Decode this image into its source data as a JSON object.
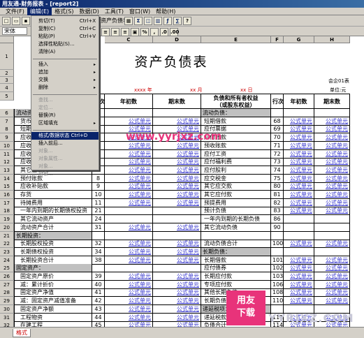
{
  "window": {
    "title": "用友通-财务报表 - [report2]"
  },
  "menubar": [
    "文件(F)",
    "编辑(E)",
    "格式(S)",
    "数据(D)",
    "工具(T)",
    "窗口(W)",
    "帮助(H)"
  ],
  "format_bar": {
    "font": "宋体"
  },
  "formula_hint": "资产负债表",
  "edit_menu": {
    "items": [
      {
        "label": "剪切(T)",
        "shortcut": "Ctrl+X",
        "state": "enabled"
      },
      {
        "label": "复制(C)",
        "shortcut": "Ctrl+C",
        "state": "enabled"
      },
      {
        "label": "粘贴(P)",
        "shortcut": "Ctrl+V",
        "state": "enabled"
      },
      {
        "label": "选择性粘贴(S)...",
        "shortcut": "",
        "state": "enabled"
      },
      {
        "label": "清除(A)",
        "shortcut": "",
        "state": "enabled"
      },
      {
        "label": "插入",
        "shortcut": "▸",
        "state": "enabled"
      },
      {
        "label": "追加",
        "shortcut": "▸",
        "state": "enabled"
      },
      {
        "label": "交换",
        "shortcut": "▸",
        "state": "enabled"
      },
      {
        "label": "删除",
        "shortcut": "▸",
        "state": "enabled"
      },
      {
        "label": "查找...",
        "shortcut": "",
        "state": "disabled"
      },
      {
        "label": "定位...",
        "shortcut": "",
        "state": "disabled"
      },
      {
        "label": "替换(R)",
        "shortcut": "",
        "state": "enabled"
      },
      {
        "label": "区域填充",
        "shortcut": "▸",
        "state": "enabled"
      },
      {
        "label": "格式/数据状态 Ctrl+D",
        "shortcut": "",
        "state": "selected"
      },
      {
        "label": "插入前后...",
        "shortcut": "",
        "state": "enabled"
      },
      {
        "label": "对象...",
        "shortcut": "",
        "state": "disabled"
      },
      {
        "label": "对象属性...",
        "shortcut": "",
        "state": "disabled"
      },
      {
        "label": "对象...",
        "shortcut": "",
        "state": "disabled"
      },
      {
        "label": "对象...",
        "shortcut": "",
        "state": "disabled"
      }
    ]
  },
  "sheet": {
    "columns": [
      "C",
      "D",
      "E",
      "F",
      "G",
      "H"
    ],
    "title": "资产负债表",
    "form_no": "会企01表",
    "unit": "单位:元",
    "year_label": "xxxx 年",
    "month_label": "xx 月",
    "day_label": "xx 日",
    "headers": {
      "row_no": "行次",
      "begin": "年初数",
      "end": "期末数",
      "liability": "负债和所有者权益",
      "liability2": "（或股东权益）",
      "row_no2": "行次",
      "begin2": "年初数",
      "end2": "期末数"
    },
    "formula_unit": "公式单元",
    "left_rows": [
      {
        "r": "6",
        "name": "流动资产：",
        "no": "",
        "f": false,
        "sec": true
      },
      {
        "r": "7",
        "name": "货币资金",
        "no": "",
        "f": true
      },
      {
        "r": "8",
        "name": "短期投资",
        "no": "",
        "f": true
      },
      {
        "r": "9",
        "name": "应收票据",
        "no": "",
        "f": true
      },
      {
        "r": "10",
        "name": "应收股利",
        "no": "",
        "f": true
      },
      {
        "r": "11",
        "name": "应收利息",
        "no": "",
        "f": true
      },
      {
        "r": "12",
        "name": "应收账款",
        "no": "",
        "f": true
      },
      {
        "r": "13",
        "name": "其它应收款",
        "no": "7",
        "f": true
      },
      {
        "r": "14",
        "name": "预付账款",
        "no": "8",
        "f": true
      },
      {
        "r": "15",
        "name": "应收补贴款",
        "no": "9",
        "f": true
      },
      {
        "r": "16",
        "name": "存货",
        "no": "10",
        "f": true
      },
      {
        "r": "17",
        "name": "待摊费用",
        "no": "11",
        "f": true
      },
      {
        "r": "18",
        "name": "一年内到期的长期债权投资",
        "no": "21",
        "f": false
      },
      {
        "r": "19",
        "name": "其它流动资产",
        "no": "24",
        "f": false
      },
      {
        "r": "20",
        "name": "流动资产合计",
        "no": "31",
        "f": true
      },
      {
        "r": "21",
        "name": "长期投资：",
        "no": "",
        "f": false,
        "sec": true
      },
      {
        "r": "22",
        "name": "长期股权投资",
        "no": "32",
        "f": true
      },
      {
        "r": "23",
        "name": "长期债权投资",
        "no": "34",
        "f": true
      },
      {
        "r": "24",
        "name": "长期投资合计",
        "no": "38",
        "f": true
      },
      {
        "r": "25",
        "name": "固定资产：",
        "no": "",
        "f": false,
        "sec": true
      },
      {
        "r": "26",
        "name": "固定资产原价",
        "no": "39",
        "f": true
      },
      {
        "r": "27",
        "name": "减：累计折价",
        "no": "40",
        "f": true
      },
      {
        "r": "28",
        "name": "固定资产净值",
        "no": "41",
        "f": true
      },
      {
        "r": "29",
        "name": "减：固定资产减值准备",
        "no": "42",
        "f": true
      },
      {
        "r": "30",
        "name": "固定资产净额",
        "no": "43",
        "f": true
      },
      {
        "r": "31",
        "name": "工程物资",
        "no": "44",
        "f": true
      },
      {
        "r": "32",
        "name": "在建工程",
        "no": "45",
        "f": true
      }
    ],
    "right_rows": [
      {
        "name": "流动负债：",
        "no": "",
        "f": false,
        "sec": true
      },
      {
        "name": "短期借款",
        "no": "68",
        "f": true
      },
      {
        "name": "应付票据",
        "no": "69",
        "f": true
      },
      {
        "name": "应付账款",
        "no": "70",
        "f": true
      },
      {
        "name": "预收账款",
        "no": "71",
        "f": true
      },
      {
        "name": "应付工资",
        "no": "72",
        "f": true
      },
      {
        "name": "应付福利费",
        "no": "73",
        "f": true
      },
      {
        "name": "应付股利",
        "no": "74",
        "f": true
      },
      {
        "name": "应交税金",
        "no": "75",
        "f": true
      },
      {
        "name": "其它应交款",
        "no": "80",
        "f": true
      },
      {
        "name": "其它应付款",
        "no": "81",
        "f": true
      },
      {
        "name": "预提费用",
        "no": "82",
        "f": true
      },
      {
        "name": "预计负债",
        "no": "83",
        "f": true
      },
      {
        "name": "一年内到期的长期负债",
        "no": "86",
        "f": false
      },
      {
        "name": "其它流动负债",
        "no": "90",
        "f": false
      },
      {
        "name": "",
        "no": "",
        "f": false
      },
      {
        "name": "流动负债合计",
        "no": "100",
        "f": true
      },
      {
        "name": "长期负债：",
        "no": "",
        "f": false,
        "sec": true
      },
      {
        "name": "长期借款",
        "no": "101",
        "f": true
      },
      {
        "name": "应付债券",
        "no": "102",
        "f": true
      },
      {
        "name": "长期应付款",
        "no": "103",
        "f": true
      },
      {
        "name": "专项应付款",
        "no": "106",
        "f": true
      },
      {
        "name": "其他长期负债",
        "no": "108",
        "f": true
      },
      {
        "name": "长期负债合计",
        "no": "110",
        "f": true
      },
      {
        "name": "递延税项：",
        "no": "",
        "f": false,
        "sec": true
      },
      {
        "name": "递延税款贷项",
        "no": "111",
        "f": true
      },
      {
        "name": "负债合计",
        "no": "114",
        "f": true
      }
    ]
  },
  "sheet_tab": "格式",
  "watermark": "www.yyrjxz.com",
  "logo": {
    "line1": "用友",
    "line2": "下载"
  },
  "logo_url": "YYRJXZ.COM"
}
